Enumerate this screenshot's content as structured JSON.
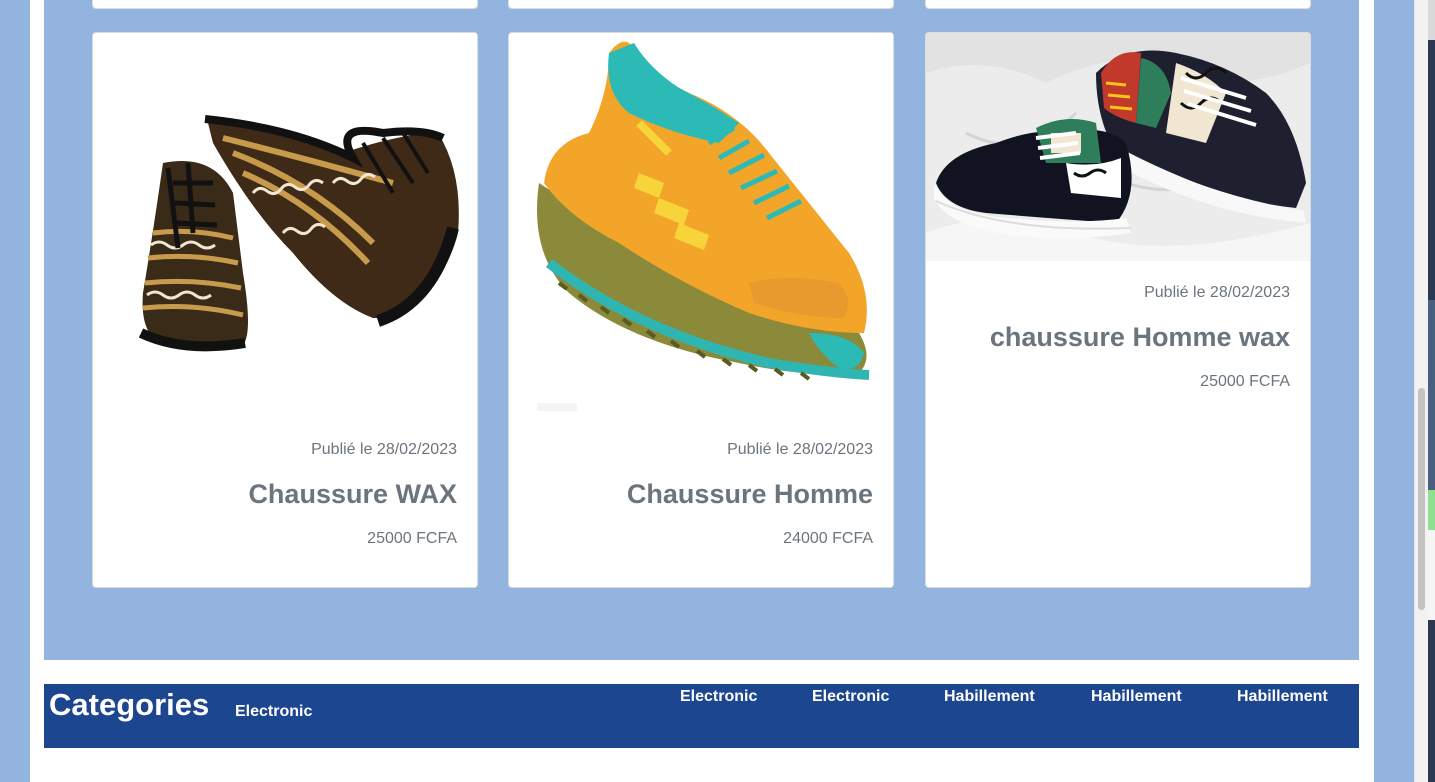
{
  "footer": {
    "title": "Categories",
    "first_category": "Electronic",
    "links": [
      "Electronic",
      "Electronic",
      "Habillement",
      "Habillement",
      "Habillement"
    ]
  },
  "products": [
    {
      "date": "Publié le 28/02/2023",
      "title": "Chaussure WAX",
      "price": "25000 FCFA"
    },
    {
      "date": "Publié le 28/02/2023",
      "title": "Chaussure Homme",
      "price": "24000 FCFA"
    },
    {
      "date": "Publié le 28/02/2023",
      "title": "chaussure Homme wax",
      "price": "25000 FCFA"
    }
  ],
  "colors": {
    "page_bg": "#94b4e0",
    "footer_bg": "#1c4690",
    "muted_text": "#6c757d"
  }
}
